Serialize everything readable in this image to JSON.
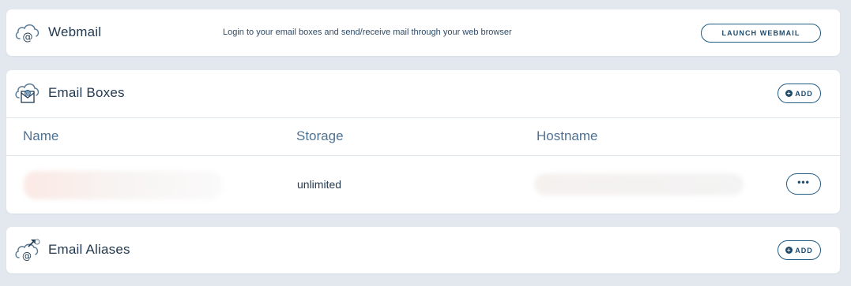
{
  "webmail": {
    "title": "Webmail",
    "description": "Login to your email boxes and send/receive mail through your web browser",
    "launch_label": "LAUNCH WEBMAIL",
    "icon": "cloud-at-icon"
  },
  "email_boxes": {
    "title": "Email Boxes",
    "add_label": "ADD",
    "icon": "cloud-envelope-icon",
    "columns": [
      "Name",
      "Storage",
      "Hostname"
    ],
    "rows": [
      {
        "name": "",
        "storage": "unlimited",
        "hostname": "",
        "actions_label": "•••"
      }
    ]
  },
  "email_aliases": {
    "title": "Email Aliases",
    "add_label": "ADD",
    "icon": "cloud-at-arrow-icon"
  },
  "colors": {
    "background": "#e2e8ee",
    "card": "#ffffff",
    "accent": "#1f5a80",
    "text": "#24394f",
    "header_text": "#4f7293"
  }
}
